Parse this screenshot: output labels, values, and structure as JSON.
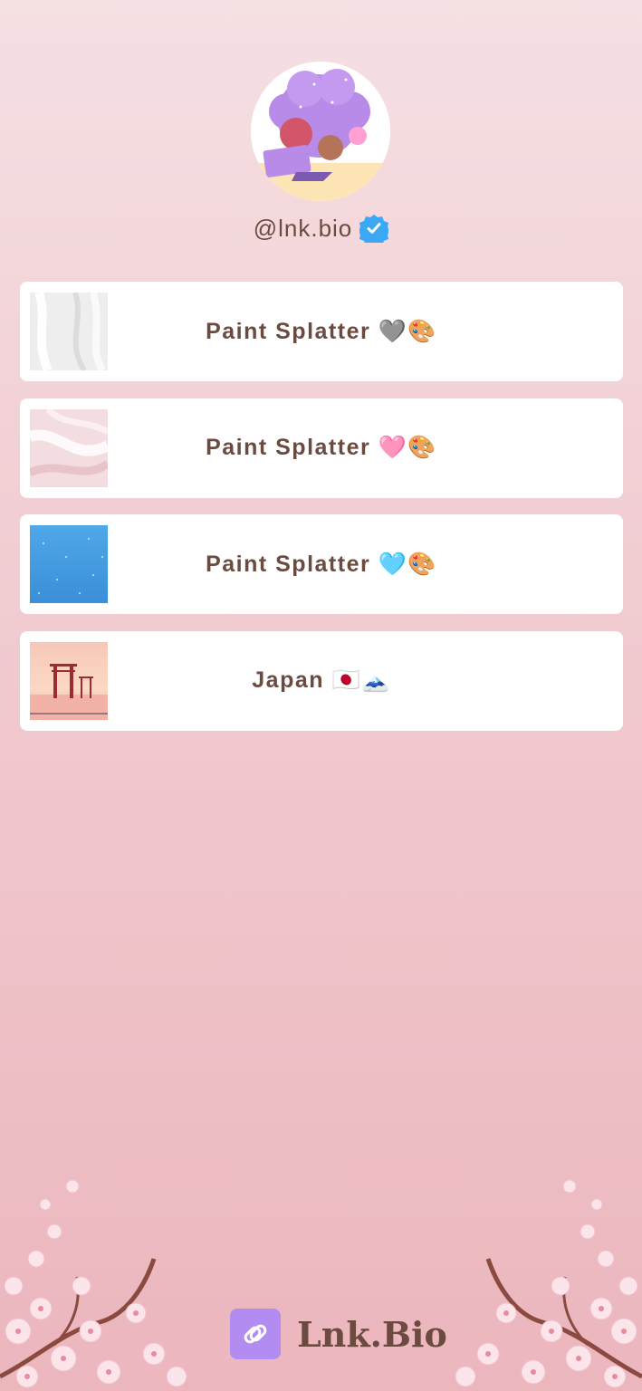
{
  "profile": {
    "handle": "@lnk.bio",
    "avatar_icon": "cartoon-avatar-icon",
    "verified_icon": "verified-badge-icon",
    "verified_color": "#3aa8f5"
  },
  "links": [
    {
      "label": "Paint Splatter 🩶🎨",
      "thumb": "white-marble-thumbnail"
    },
    {
      "label": "Paint Splatter 🩷🎨",
      "thumb": "pink-marble-thumbnail"
    },
    {
      "label": "Paint Splatter 🩵🎨",
      "thumb": "blue-water-thumbnail"
    },
    {
      "label": "Japan 🇯🇵🗻",
      "thumb": "torii-gate-thumbnail"
    }
  ],
  "footer": {
    "brand": "Lnk.Bio",
    "logo_icon": "link-icon",
    "logo_color": "#b28cf0"
  },
  "colors": {
    "text": "#6b4b40",
    "background_top": "#f5e0e3",
    "background_bottom": "#ecb6bd"
  }
}
